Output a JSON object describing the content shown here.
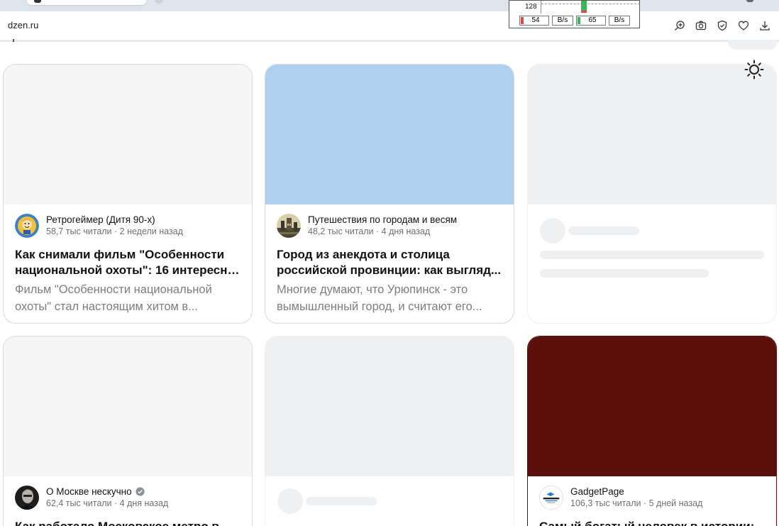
{
  "browser": {
    "url": "dzen.ru"
  },
  "netmeter": {
    "scale_label": "128",
    "download_value": "54",
    "download_unit": "B/s",
    "upload_value": "65",
    "upload_unit": "B/s"
  },
  "cards": [
    {
      "channel_name": "Ретрогеймер (Дитя 90-х)",
      "meta": "58,7 тыс читали · 2 недели назад",
      "title_lines": [
        "Как снимали фильм \"Особенности",
        "национальной охоты\": 16 интересны..."
      ],
      "snippet_lines": [
        "Фильм \"Особенности национальной",
        "охоты\" стал настоящим хитом в..."
      ],
      "image_color": "#f5f5f5",
      "avatar_icon": "vault-boy-avatar-icon"
    },
    {
      "channel_name": "Путешествия по городам и весям",
      "meta": "48,2 тыс читали · 4 дня назад",
      "title_lines": [
        "Город из анекдота и столица",
        "российской провинции: как выгляд..."
      ],
      "snippet_lines": [
        "Многие думают, что Урюпинск - это",
        "вымышленный город, и считают его..."
      ],
      "image_color": "#aecfee",
      "avatar_icon": "town-photo-avatar-icon"
    },
    {
      "channel_name": "О Москве нескучно",
      "meta": "62,4 тыс читали · 4 дня назад",
      "title_lines": [
        "Как работало Московское метро в"
      ],
      "image_color": "#f5f5f5",
      "avatar_icon": "portrait-avatar-icon"
    },
    {
      "channel_name": "GadgetPage",
      "meta": "106,3 тыс читали · 5 дней назад",
      "title_lines": [
        "Самый богатый человек в истории:"
      ],
      "image_color": "#5c100c",
      "avatar_icon": "gadgetpage-logo-icon"
    }
  ],
  "colors": {
    "skeleton": "#eef0f2",
    "card_border": "#d6d8da",
    "muted_text": "#7a7d82"
  }
}
